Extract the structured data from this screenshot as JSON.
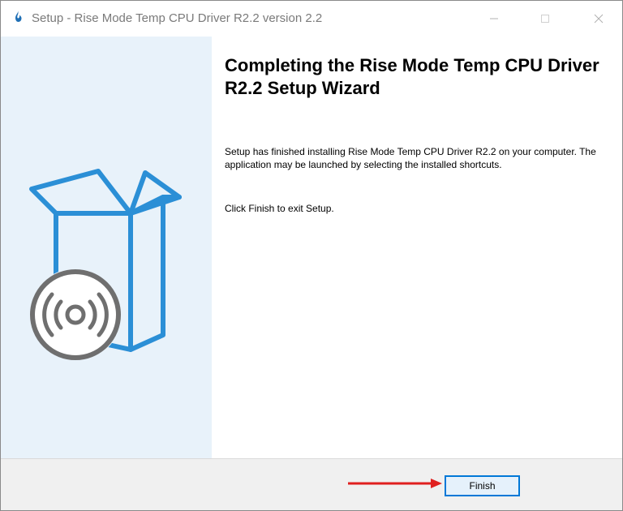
{
  "window": {
    "title": "Setup - Rise Mode Temp CPU Driver R2.2 version 2.2",
    "app_icon": "flame-icon",
    "controls": [
      "minimize-icon",
      "maximize-icon",
      "close-icon"
    ]
  },
  "sidebar": {
    "illustration": "software-box-disc-icon",
    "colors": {
      "background": "#e8f2fa",
      "box": "#2b8fd6",
      "disc": "#6f6f6f"
    }
  },
  "main": {
    "heading": "Completing the Rise Mode Temp CPU Driver R2.2 Setup Wizard",
    "description": "Setup has finished installing Rise Mode Temp CPU Driver R2.2 on your computer. The application may be launched by selecting the installed shortcuts.",
    "exit_instruction": "Click Finish to exit Setup."
  },
  "footer": {
    "finish_label": "Finish",
    "annotation_arrow": "red-arrow-icon",
    "colors": {
      "arrow": "#e0201f",
      "button_border": "#0078d7"
    }
  }
}
